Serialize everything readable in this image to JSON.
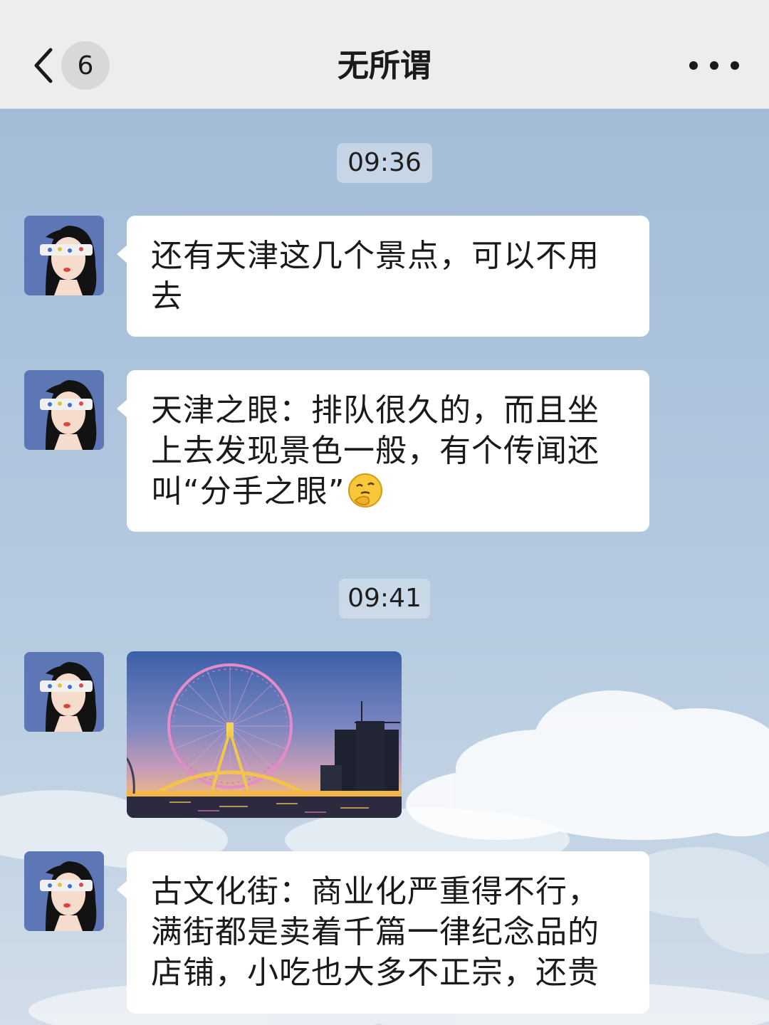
{
  "header": {
    "back_icon": "chevron-left-icon",
    "unread_count": "6",
    "title": "无所谓",
    "more_icon": "more-dots-icon"
  },
  "timestamps": [
    "09:36",
    "09:41"
  ],
  "messages": [
    {
      "type": "text",
      "text": "还有天津这几个景点，可以不用去"
    },
    {
      "type": "text",
      "text": "天津之眼：排队很久的，而且坐上去发现景色一般，有个传闻还叫“分手之眼”",
      "emoji": "thinking-face-emoji"
    },
    {
      "type": "image",
      "image": "tianjin-eye-ferris-wheel-photo"
    },
    {
      "type": "text",
      "text": "古文化街：商业化严重得不行，满街都是卖着千篇一律纪念品的店铺，小吃也大多不正宗，还贵"
    }
  ],
  "colors": {
    "header_bg": "#ededed",
    "bubble_bg": "#ffffff",
    "chat_bg": "#a9c1db",
    "avatar_bg": "#5d77b6"
  }
}
